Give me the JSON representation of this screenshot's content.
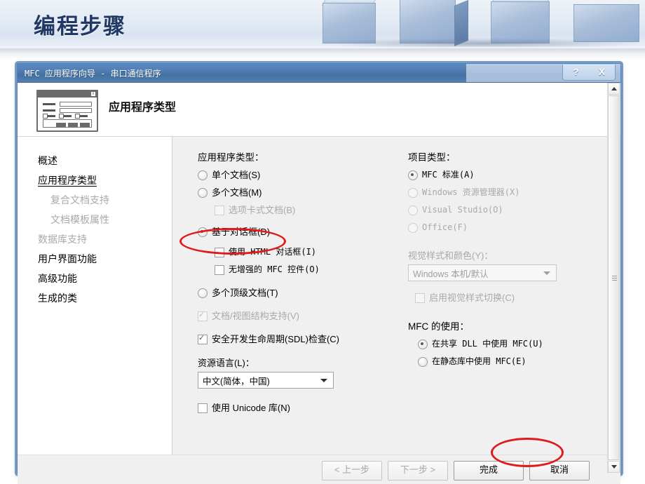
{
  "slide": {
    "title": "编程步骤",
    "accent_color": "#1f3864",
    "band_color": "#e3eaf4"
  },
  "dialog": {
    "titlebar": {
      "text": "MFC 应用程序向导 - 串口通信程序",
      "help_button": "?",
      "close_button": "X"
    },
    "banner": {
      "heading": "应用程序类型",
      "icon": "dialog-mockup-icon"
    },
    "sidebar": {
      "items": [
        {
          "label": "概述",
          "state": "normal",
          "indent": false
        },
        {
          "label": "应用程序类型",
          "state": "selected",
          "indent": false
        },
        {
          "label": "复合文档支持",
          "state": "disabled",
          "indent": true
        },
        {
          "label": "文档模板属性",
          "state": "disabled",
          "indent": true
        },
        {
          "label": "数据库支持",
          "state": "disabled",
          "indent": false
        },
        {
          "label": "用户界面功能",
          "state": "normal",
          "indent": false
        },
        {
          "label": "高级功能",
          "state": "normal",
          "indent": false
        },
        {
          "label": "生成的类",
          "state": "normal",
          "indent": false
        }
      ]
    },
    "app_type": {
      "group_label": "应用程序类型：",
      "options": [
        {
          "label": "单个文档(S)",
          "type": "radio",
          "checked": false,
          "disabled": false,
          "indent": 0
        },
        {
          "label": "多个文档(M)",
          "type": "radio",
          "checked": false,
          "disabled": false,
          "indent": 0
        },
        {
          "label": "选项卡式文档(B)",
          "type": "checkbox",
          "checked": false,
          "disabled": true,
          "indent": 1
        },
        {
          "label": "基于对话框(D)",
          "type": "radio",
          "checked": true,
          "disabled": false,
          "indent": 0
        },
        {
          "label": "使用 HTML 对话框(I)",
          "type": "checkbox",
          "checked": false,
          "disabled": false,
          "indent": 1
        },
        {
          "label": "无增强的 MFC 控件(O)",
          "type": "checkbox",
          "checked": false,
          "disabled": false,
          "indent": 1
        },
        {
          "label": "多个顶级文档(T)",
          "type": "radio",
          "checked": false,
          "disabled": false,
          "indent": 0
        }
      ],
      "extra_options": [
        {
          "label": "文档/视图结构支持(V)",
          "type": "checkbox",
          "checked": true,
          "disabled": true
        },
        {
          "label": "安全开发生命周期(SDL)检查(C)",
          "type": "checkbox",
          "checked": true,
          "disabled": false
        }
      ],
      "resource_language_label": "资源语言(L)：",
      "resource_language_value": "中文(简体，中国)",
      "unicode_option": {
        "label": "使用 Unicode 库(N)",
        "type": "checkbox",
        "checked": false,
        "disabled": false
      }
    },
    "project_type": {
      "group_label": "项目类型：",
      "options": [
        {
          "label": "MFC 标准(A)",
          "checked": true,
          "disabled": false
        },
        {
          "label": "Windows 资源管理器(X)",
          "checked": false,
          "disabled": true
        },
        {
          "label": "Visual Studio(O)",
          "checked": false,
          "disabled": true
        },
        {
          "label": "Office(F)",
          "checked": false,
          "disabled": true
        }
      ],
      "visual_style_label": "视觉样式和颜色(Y)：",
      "visual_style_value": "Windows 本机/默认",
      "visual_style_disabled": true,
      "style_switch_option": {
        "label": "启用视觉样式切换(C)",
        "checked": false,
        "disabled": true
      },
      "mfc_usage_label": "MFC 的使用：",
      "mfc_usage_options": [
        {
          "label": "在共享 DLL 中使用 MFC(U)",
          "checked": true,
          "disabled": false
        },
        {
          "label": "在静态库中使用 MFC(E)",
          "checked": false,
          "disabled": false
        }
      ]
    },
    "footer_buttons": [
      {
        "label": "< 上一步",
        "disabled": true
      },
      {
        "label": "下一步 >",
        "disabled": true
      },
      {
        "label": "完成",
        "disabled": false,
        "highlighted": true
      },
      {
        "label": "取消",
        "disabled": false
      }
    ]
  },
  "annotations": {
    "color": "#e01b1b",
    "items": [
      {
        "name": "dialog-based-highlight",
        "target": "基于对话框(D)"
      },
      {
        "name": "finish-button-highlight",
        "target": "完成"
      }
    ]
  }
}
